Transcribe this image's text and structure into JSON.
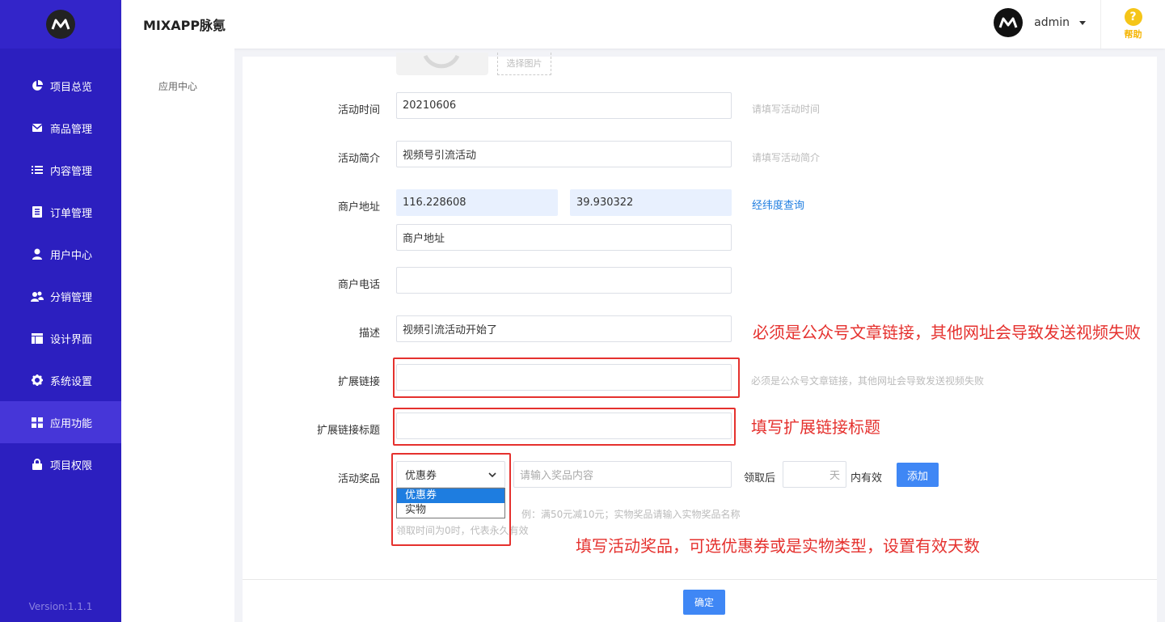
{
  "app": {
    "brand": "MIXAPP脉氪",
    "version": "Version:1.1.1"
  },
  "sidebar": {
    "items": [
      {
        "label": "项目总览",
        "icon": "pie-chart-icon"
      },
      {
        "label": "商品管理",
        "icon": "envelope-icon"
      },
      {
        "label": "内容管理",
        "icon": "list-icon"
      },
      {
        "label": "订单管理",
        "icon": "order-icon"
      },
      {
        "label": "用户中心",
        "icon": "user-icon"
      },
      {
        "label": "分销管理",
        "icon": "users-icon"
      },
      {
        "label": "设计界面",
        "icon": "layout-icon"
      },
      {
        "label": "系统设置",
        "icon": "gear-icon"
      },
      {
        "label": "应用功能",
        "icon": "grid-icon",
        "active": true
      },
      {
        "label": "项目权限",
        "icon": "lock-icon"
      }
    ]
  },
  "header": {
    "user": "admin",
    "help": "帮助"
  },
  "subnav": {
    "item": "应用中心"
  },
  "form": {
    "image_pick": "选择图片",
    "time": {
      "label": "活动时间",
      "value": "20210606",
      "hint": "请填写活动时间"
    },
    "intro": {
      "label": "活动简介",
      "value": "视频号引流活动",
      "hint": "请填写活动简介"
    },
    "address": {
      "label": "商户地址",
      "lng": "116.228608",
      "lat": "39.930322",
      "link": "经纬度查询",
      "placeholder": "商户地址"
    },
    "phone": {
      "label": "商户电话",
      "value": ""
    },
    "desc": {
      "label": "描述",
      "value": "视频引流活动开始了"
    },
    "ext_link": {
      "label": "扩展链接",
      "value": "",
      "hint": "必须是公众号文章链接，其他网址会导致发送视频失败"
    },
    "ext_title": {
      "label": "扩展链接标题",
      "value": ""
    },
    "prize": {
      "label": "活动奖品",
      "type_selected": "优惠券",
      "options": [
        "优惠券",
        "实物"
      ],
      "content_placeholder": "请输入奖品内容",
      "after_label": "领取后",
      "days_unit": "天",
      "valid_label": "内有效",
      "add_button": "添加",
      "hint1": "例：满50元减10元；实物奖品请输入实物奖品名称",
      "hint2": "领取时间为0时，代表永久有效"
    },
    "submit": "确定"
  },
  "annotations": {
    "note1": "必须是公众号文章链接，其他网址会导致发送视频失败",
    "note2": "填写扩展链接标题",
    "note3": "填写活动奖品，可选优惠券或是实物类型，设置有效天数"
  },
  "colors": {
    "sidebar": "#2c1fbf",
    "accent": "#3f87f5",
    "annotation": "#e5312e"
  }
}
